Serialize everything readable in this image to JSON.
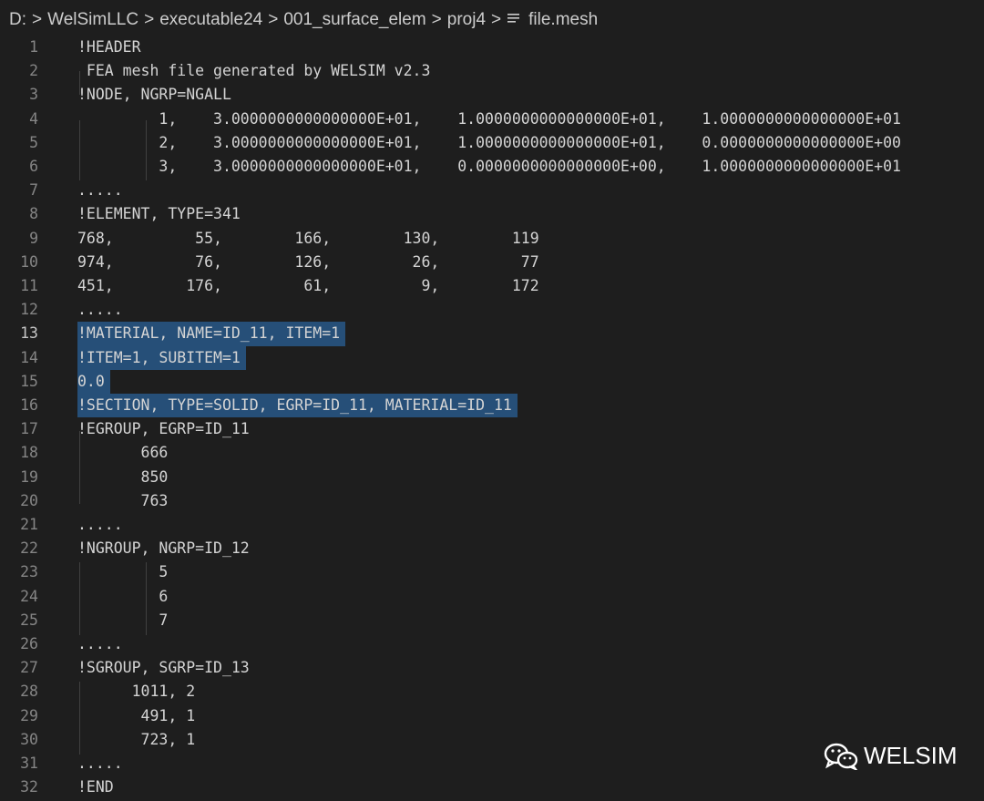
{
  "breadcrumb": {
    "items": [
      "D:",
      "WelSimLLC",
      "executable24",
      "001_surface_elem",
      "proj4"
    ],
    "separator": ">",
    "file": "file.mesh",
    "file_icon": "lines-icon"
  },
  "editor": {
    "active_line": 13,
    "selection_color": "#264f78",
    "lines": [
      {
        "n": "1",
        "text": "!HEADER"
      },
      {
        "n": "2",
        "text": " FEA mesh file generated by WELSIM v2.3"
      },
      {
        "n": "3",
        "text": "!NODE, NGRP=NGALL"
      },
      {
        "n": "4",
        "text": "         1,    3.0000000000000000E+01,    1.0000000000000000E+01,    1.0000000000000000E+01"
      },
      {
        "n": "5",
        "text": "         2,    3.0000000000000000E+01,    1.0000000000000000E+01,    0.0000000000000000E+00"
      },
      {
        "n": "6",
        "text": "         3,    3.0000000000000000E+01,    0.0000000000000000E+00,    1.0000000000000000E+01"
      },
      {
        "n": "7",
        "text": "....."
      },
      {
        "n": "8",
        "text": "!ELEMENT, TYPE=341"
      },
      {
        "n": "9",
        "text": "768,         55,        166,        130,        119"
      },
      {
        "n": "10",
        "text": "974,         76,        126,         26,         77"
      },
      {
        "n": "11",
        "text": "451,        176,         61,          9,        172"
      },
      {
        "n": "12",
        "text": "....."
      },
      {
        "n": "13",
        "text": "!MATERIAL, NAME=ID_11, ITEM=1",
        "selected": true
      },
      {
        "n": "14",
        "text": "!ITEM=1, SUBITEM=1",
        "selected": true
      },
      {
        "n": "15",
        "text": "0.0",
        "selected": true
      },
      {
        "n": "16",
        "text": "!SECTION, TYPE=SOLID, EGRP=ID_11, MATERIAL=ID_11",
        "selected": true
      },
      {
        "n": "17",
        "text": "!EGROUP, EGRP=ID_11"
      },
      {
        "n": "18",
        "text": "       666"
      },
      {
        "n": "19",
        "text": "       850"
      },
      {
        "n": "20",
        "text": "       763"
      },
      {
        "n": "21",
        "text": "....."
      },
      {
        "n": "22",
        "text": "!NGROUP, NGRP=ID_12"
      },
      {
        "n": "23",
        "text": "         5"
      },
      {
        "n": "24",
        "text": "         6"
      },
      {
        "n": "25",
        "text": "         7"
      },
      {
        "n": "26",
        "text": "....."
      },
      {
        "n": "27",
        "text": "!SGROUP, SGRP=ID_13"
      },
      {
        "n": "28",
        "text": "      1011, 2"
      },
      {
        "n": "29",
        "text": "       491, 1"
      },
      {
        "n": "30",
        "text": "       723, 1"
      },
      {
        "n": "31",
        "text": "....."
      },
      {
        "n": "32",
        "text": "!END"
      }
    ]
  },
  "watermark": {
    "text": "WELSIM",
    "icon": "wechat-icon"
  }
}
